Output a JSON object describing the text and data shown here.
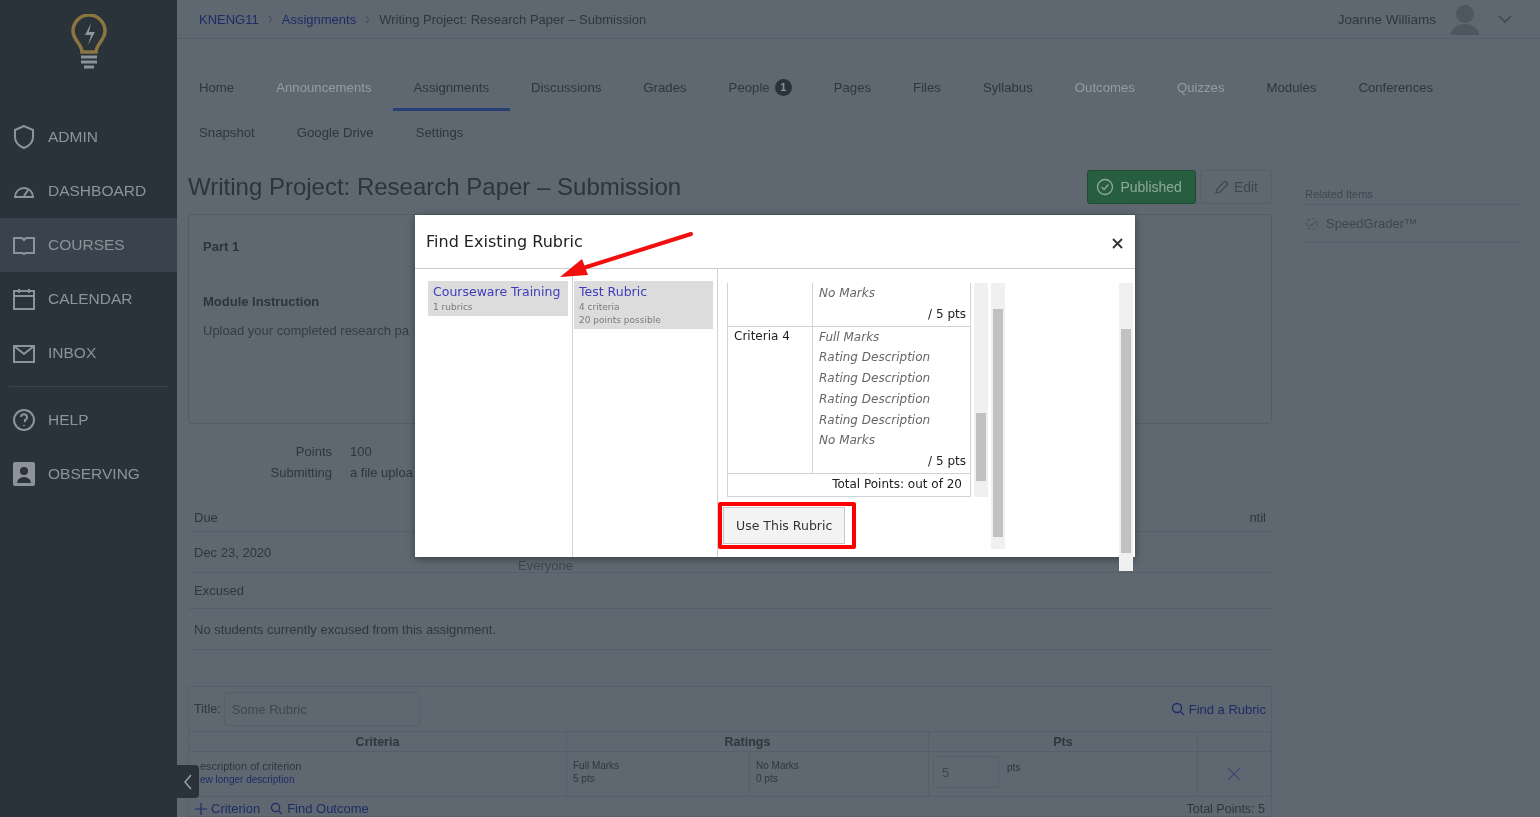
{
  "sidebar": {
    "groups": [
      [
        {
          "label": "ADMIN",
          "selected": false
        },
        {
          "label": "DASHBOARD",
          "selected": false
        },
        {
          "label": "COURSES",
          "selected": true
        },
        {
          "label": "CALENDAR",
          "selected": false
        },
        {
          "label": "INBOX",
          "selected": false
        }
      ],
      [
        {
          "label": "HELP",
          "selected": false
        },
        {
          "label": "OBSERVING",
          "selected": false
        }
      ]
    ]
  },
  "breadcrumbs": [
    "KNENG11",
    "Assignments",
    "Writing Project: Research Paper – Submission"
  ],
  "user": {
    "name": "Joanne Williams"
  },
  "course_nav": [
    [
      {
        "label": "Home",
        "selected": false,
        "disabled": false
      },
      {
        "label": "Announcements",
        "selected": false,
        "disabled": true
      },
      {
        "label": "Assignments",
        "selected": true,
        "disabled": false
      },
      {
        "label": "Discussions",
        "selected": false,
        "disabled": false
      },
      {
        "label": "Grades",
        "selected": false,
        "disabled": false
      },
      {
        "label": "People",
        "selected": false,
        "disabled": false,
        "badge": "1"
      },
      {
        "label": "Pages",
        "selected": false,
        "disabled": false
      },
      {
        "label": "Files",
        "selected": false,
        "disabled": false
      },
      {
        "label": "Syllabus",
        "selected": false,
        "disabled": false
      },
      {
        "label": "Outcomes",
        "selected": false,
        "disabled": true
      },
      {
        "label": "Quizzes",
        "selected": false,
        "disabled": true
      },
      {
        "label": "Modules",
        "selected": false,
        "disabled": false
      },
      {
        "label": "Conferences",
        "selected": false,
        "disabled": false
      }
    ],
    [
      {
        "label": "Snapshot",
        "selected": false,
        "disabled": false
      },
      {
        "label": "Google Drive",
        "selected": false,
        "disabled": false
      },
      {
        "label": "Settings",
        "selected": false,
        "disabled": false
      }
    ]
  ],
  "page": {
    "title": "Writing Project: Research Paper – Submission",
    "published_button": "Published",
    "edit_button": "Edit"
  },
  "related": {
    "heading": "Related Items",
    "items": [
      "SpeedGrader™"
    ]
  },
  "description": {
    "heading": "Part 1",
    "subheading": "Module Instruction",
    "text": "Upload your completed research pa"
  },
  "details": [
    {
      "label": "Points",
      "value": "100"
    },
    {
      "label": "Submitting",
      "value": "a file uploa"
    }
  ],
  "dates": {
    "columns": [
      "Due",
      "ntil"
    ],
    "rows": [
      [
        "Dec 23, 2020",
        "Everyone"
      ]
    ]
  },
  "excused": {
    "heading": "Excused",
    "text": "No students currently excused from this assignment."
  },
  "rubric": {
    "title_label": "Title:",
    "title_value": "Some Rubric",
    "find_link": "Find a Rubric",
    "columns": [
      "Criteria",
      "Ratings",
      "Pts"
    ],
    "criteria": [
      {
        "description": "escription of criterion",
        "long_description": "ew longer description",
        "ratings": [
          {
            "label": "Full Marks",
            "points": "5 pts"
          },
          {
            "label": "No Marks",
            "points": "0 pts"
          }
        ],
        "points": "5",
        "unit": "pts"
      }
    ],
    "add_criterion": "Criterion",
    "find_outcome": "Find Outcome",
    "total": "Total Points: 5"
  },
  "modal": {
    "title": "Find Existing Rubric",
    "contexts": [
      {
        "name": "Courseware Training",
        "count": "1 rubrics",
        "selected": true
      }
    ],
    "rubrics": [
      {
        "name": "Test Rubric",
        "criteria": "4 criteria",
        "points": "20 points possible",
        "selected": true
      }
    ],
    "preview": {
      "rows": [
        {
          "ratings": [
            "No Marks"
          ],
          "points": "/ 5 pts"
        },
        {
          "criterion": "Criteria 4",
          "ratings": [
            "Full Marks",
            "Rating Description",
            "Rating Description",
            "Rating Description",
            "Rating Description",
            "No Marks"
          ],
          "points": "/ 5 pts"
        }
      ],
      "total": "Total Points: out of 20"
    },
    "button": "Use This Rubric"
  }
}
